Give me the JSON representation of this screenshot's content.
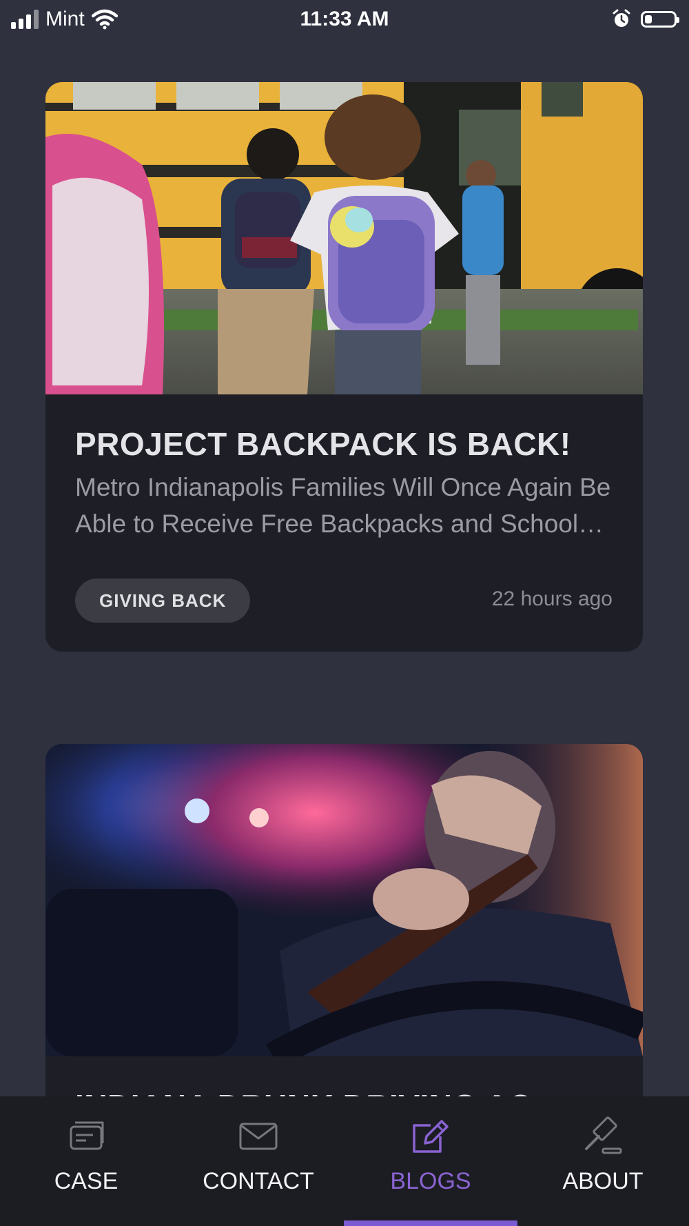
{
  "status_bar": {
    "carrier": "Mint",
    "time": "11:33 AM",
    "battery_level": 0.25
  },
  "posts": [
    {
      "title": "PROJECT BACKPACK IS BACK!",
      "description": "Metro Indianapolis Families Will Once Again Be Able to Receive Free Backpacks and School Supplies",
      "tag": "GIVING BACK",
      "time_ago": "22 hours ago"
    },
    {
      "title": "INDIANA DRUNK DRIVING AC"
    }
  ],
  "bottom_nav": {
    "items": [
      {
        "label": "CASE",
        "icon": "case-cards-icon"
      },
      {
        "label": "CONTACT",
        "icon": "envelope-icon"
      },
      {
        "label": "BLOGS",
        "icon": "edit-pencil-icon"
      },
      {
        "label": "ABOUT",
        "icon": "gavel-icon"
      }
    ],
    "active_index": 2
  },
  "colors": {
    "background": "#2f313f",
    "card": "#1d1e26",
    "accent": "#7c5ad2",
    "nav_background": "#1c1d23"
  }
}
